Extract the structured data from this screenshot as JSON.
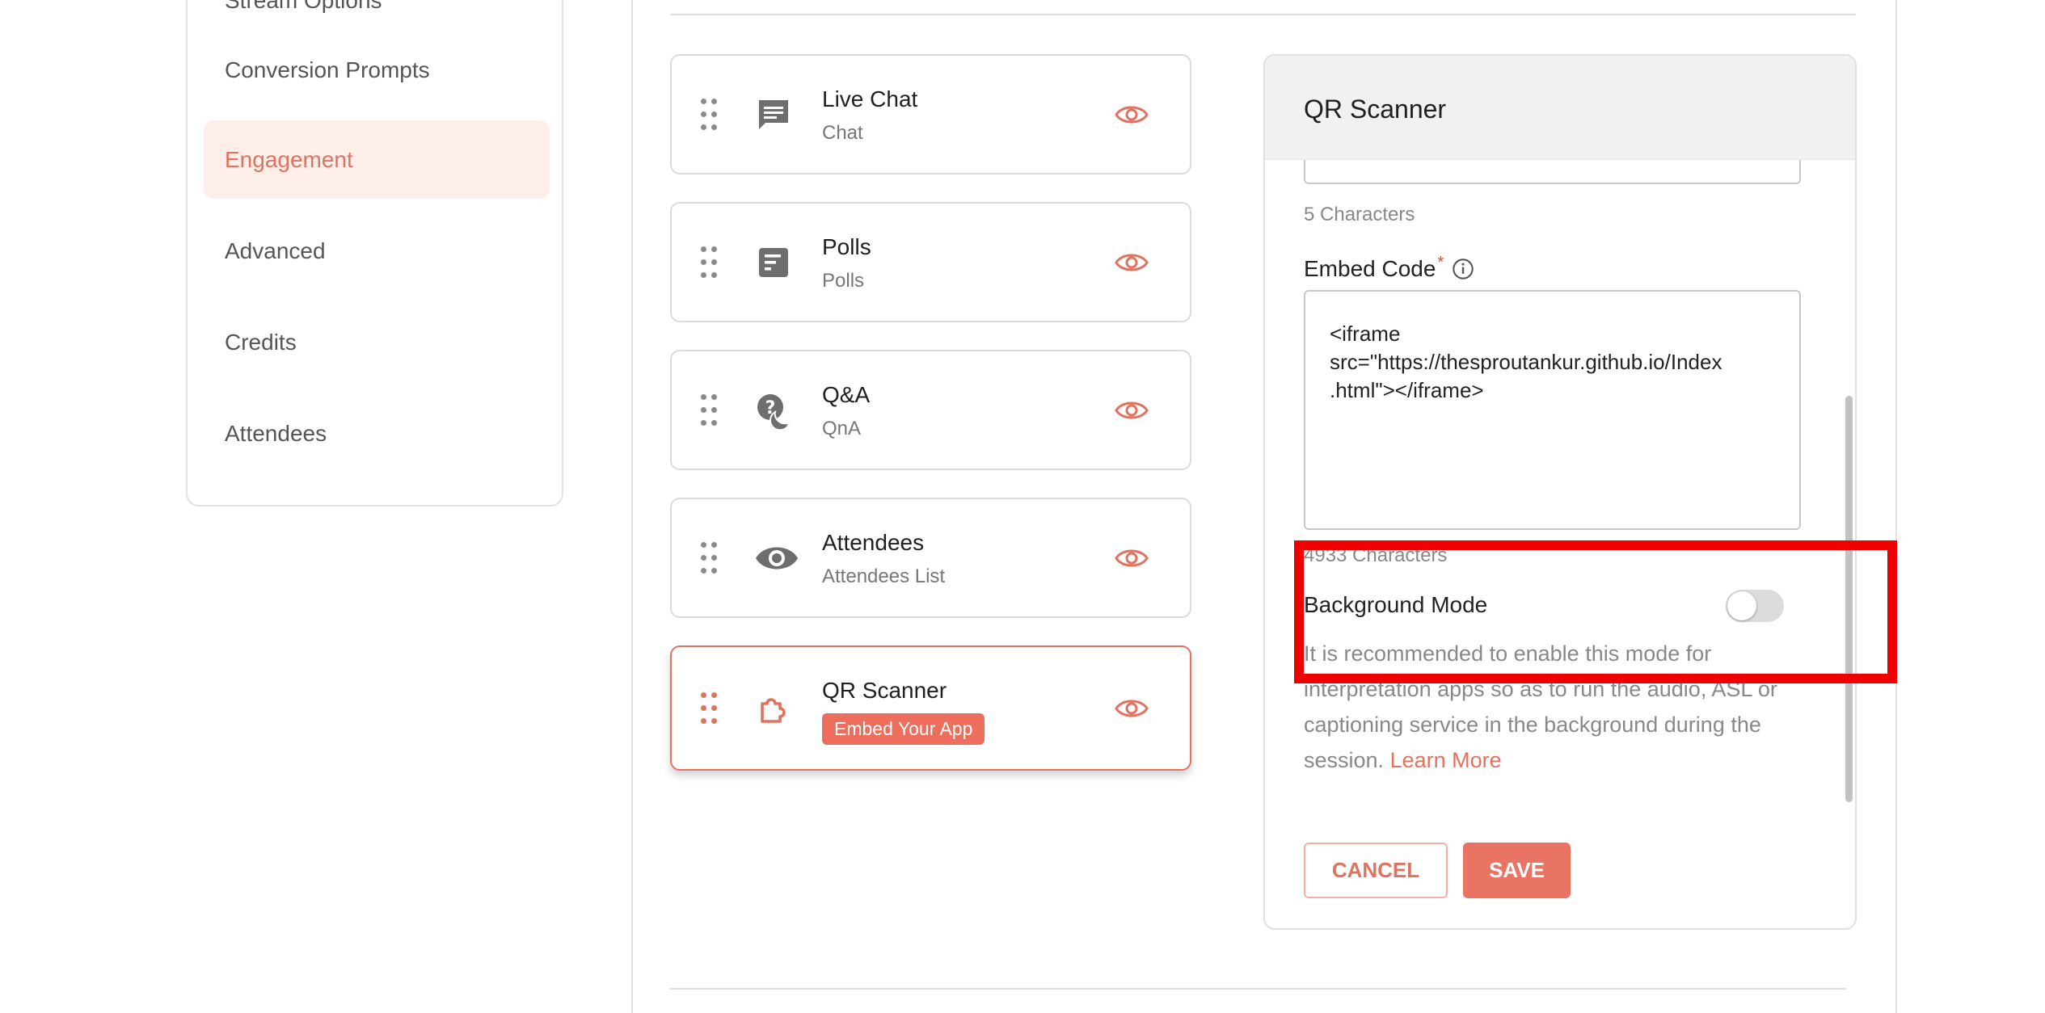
{
  "sidebar": {
    "items": [
      {
        "label": "Stream Options",
        "active": false
      },
      {
        "label": "Conversion Prompts",
        "active": false
      },
      {
        "label": "Engagement",
        "active": true
      },
      {
        "label": "Advanced",
        "active": false
      },
      {
        "label": "Credits",
        "active": false
      },
      {
        "label": "Attendees",
        "active": false
      }
    ]
  },
  "widgets": [
    {
      "title": "Live Chat",
      "subtitle": "Chat",
      "icon": "chat-icon"
    },
    {
      "title": "Polls",
      "subtitle": "Polls",
      "icon": "poll-icon"
    },
    {
      "title": "Q&A",
      "subtitle": "QnA",
      "icon": "qna-icon"
    },
    {
      "title": "Attendees",
      "subtitle": "Attendees List",
      "icon": "eye-icon"
    },
    {
      "title": "QR Scanner",
      "badge": "Embed Your App",
      "icon": "puzzle-icon",
      "active": true
    }
  ],
  "panel": {
    "title": "QR Scanner",
    "name_count": "5 Characters",
    "embed_label": "Embed Code",
    "required_mark": "*",
    "embed_value": "<iframe\nsrc=\"https://thesproutankur.github.io/Index\n.html\"></iframe>",
    "embed_count": "4933 Characters",
    "background_mode_label": "Background Mode",
    "background_mode_on": false,
    "description": "It is recommended to enable this mode for interpretation apps so as to run the audio, ASL or captioning service in the background during the session.",
    "learn_more": "Learn More",
    "cancel_label": "CANCEL",
    "save_label": "SAVE"
  },
  "colors": {
    "accent": "#e0735f",
    "highlight": "#f00000"
  }
}
